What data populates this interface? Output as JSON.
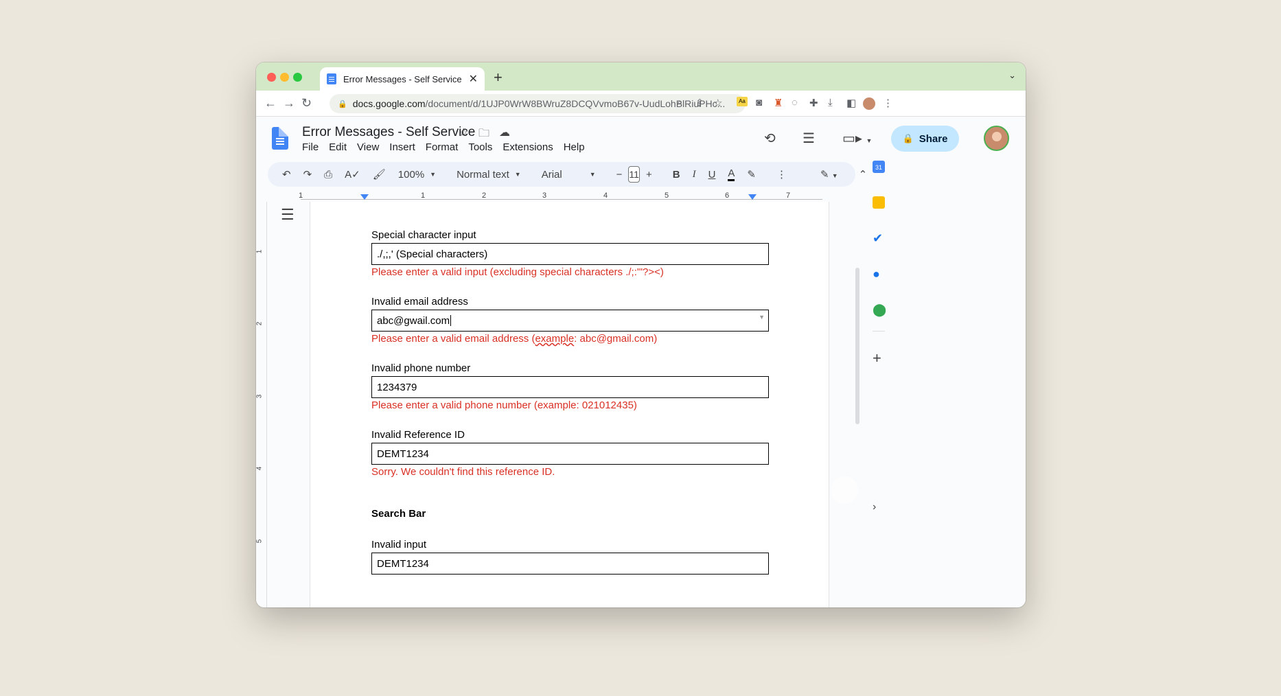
{
  "browser": {
    "tab_title": "Error Messages - Self Service",
    "tab_close": "✕",
    "new_tab": "+",
    "url_host": "docs.google.com",
    "url_path": "/document/d/1UJP0WrW8BWruZ8DCQVvmoB67v-UudLohBlRiuPHc..."
  },
  "docs": {
    "title": "Error Messages - Self Service",
    "menu": [
      "File",
      "Edit",
      "View",
      "Insert",
      "Format",
      "Tools",
      "Extensions",
      "Help"
    ],
    "share_label": "Share",
    "toolbar": {
      "zoom": "100%",
      "style": "Normal text",
      "font": "Arial",
      "size": "11"
    },
    "ruler_h": [
      "1",
      "1",
      "2",
      "3",
      "4",
      "5",
      "6",
      "7"
    ],
    "ruler_v": [
      "1",
      "2",
      "3",
      "4",
      "5"
    ]
  },
  "content": {
    "fields": [
      {
        "label": "Special character input",
        "value": "./,;,' (Special characters)",
        "error": "Please enter a valid input (excluding special characters ./;:'\"?><)"
      },
      {
        "label": "Invalid email address",
        "value": "abc@gwail.com",
        "error_pre": "Please enter a valid email address (",
        "error_ul": "example",
        "error_post": ": abc@gmail.com)"
      },
      {
        "label": "Invalid phone number",
        "value": "1234379",
        "error": "Please enter a valid phone number (example: 021012435)"
      },
      {
        "label": "Invalid Reference ID",
        "value": "DEMT1234",
        "error": "Sorry. We couldn't find this reference ID."
      }
    ],
    "section_title": "Search Bar",
    "search": {
      "label": "Invalid input",
      "value": "DEMT1234"
    }
  },
  "colors": {
    "error": "#D93025",
    "share_bg": "#C2E7FF",
    "tabstrip": "#D3E8C6"
  }
}
